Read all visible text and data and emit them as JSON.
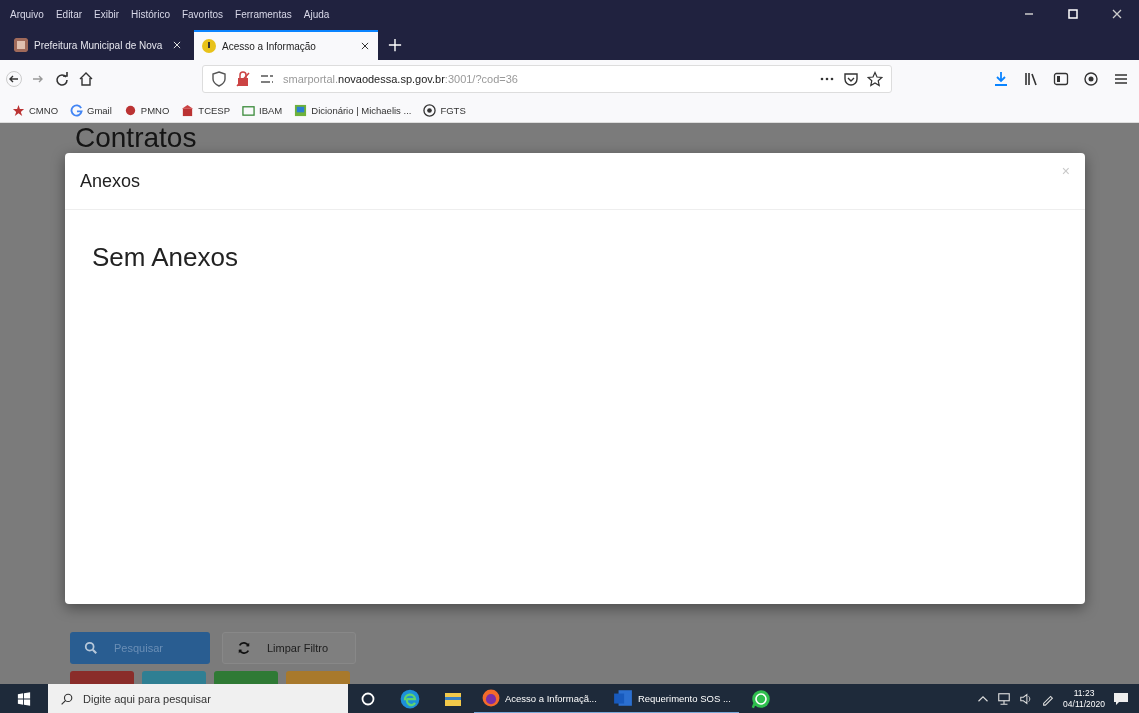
{
  "menu": [
    "Arquivo",
    "Editar",
    "Exibir",
    "Histórico",
    "Favoritos",
    "Ferramentas",
    "Ajuda"
  ],
  "tabs": [
    {
      "label": "Prefeitura Municipal de Nova",
      "selected": false
    },
    {
      "label": "Acesso a Informação",
      "selected": true
    }
  ],
  "address": {
    "prefix": "smarportal.",
    "domain": "novaodessa.sp.gov.br",
    "suffix": ":3001/?cod=36"
  },
  "bookmarks": [
    "CMNO",
    "Gmail",
    "PMNO",
    "TCESP",
    "IBAM",
    "Dicionário | Michaelis ...",
    "FGTS"
  ],
  "page": {
    "heading": "Contratos",
    "buttons": [
      {
        "label": "Pesquisar",
        "kind": "primary"
      },
      {
        "label": "Limpar Filtro",
        "kind": "default"
      }
    ],
    "action_buttons": [
      {
        "color": "#8a2d2a"
      },
      {
        "color": "#2f7f93"
      },
      {
        "color": "#2f7a35"
      },
      {
        "color": "#a8792c"
      }
    ]
  },
  "modal": {
    "title": "Anexos",
    "close": "×",
    "body": "Sem Anexos"
  },
  "taskbar": {
    "search_placeholder": "Digite aqui para pesquisar",
    "apps": [
      {
        "label": "Acesso a Informaçã...",
        "kind": "firefox"
      },
      {
        "label": "Requerimento SOS ...",
        "kind": "word"
      }
    ],
    "time": "11:23",
    "date": "04/11/2020"
  }
}
